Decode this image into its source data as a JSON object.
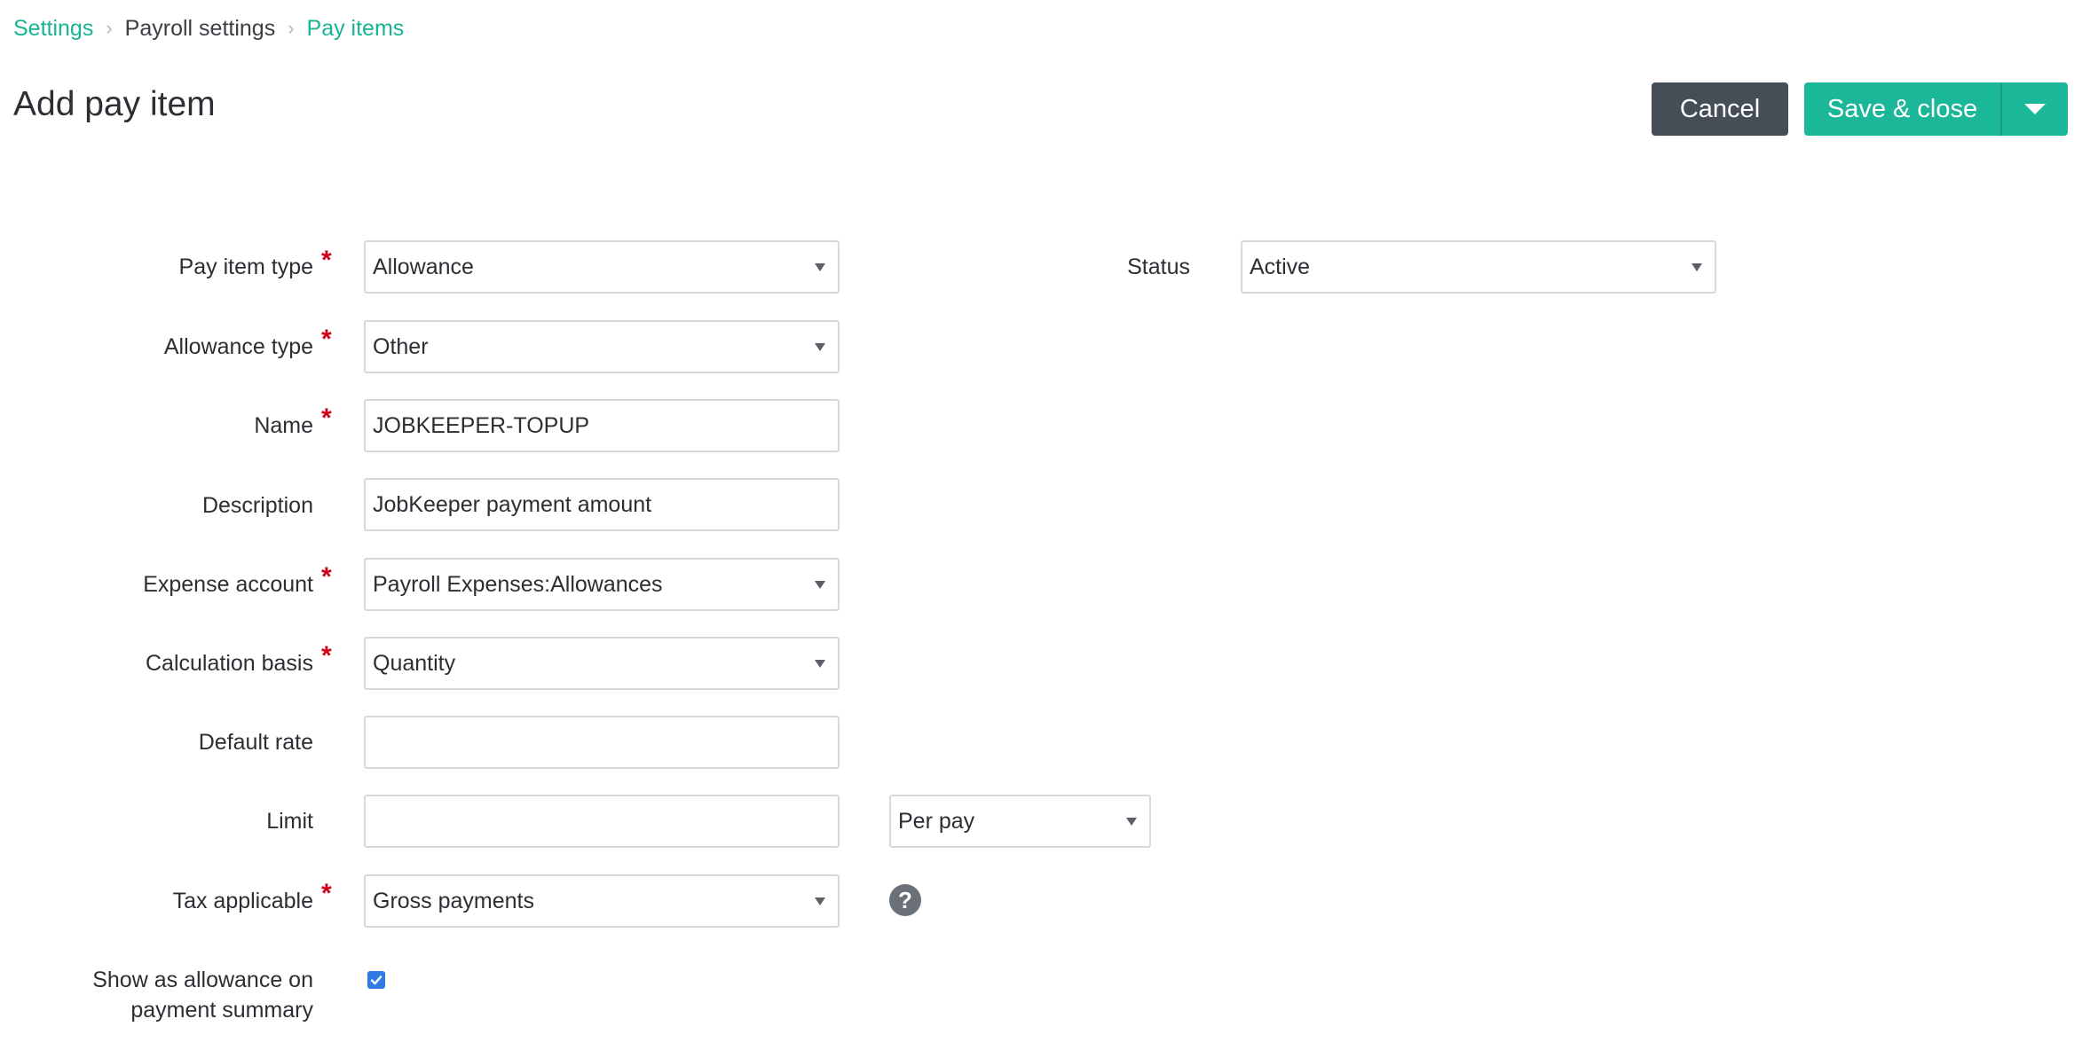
{
  "breadcrumb": {
    "items": [
      {
        "label": "Settings",
        "link": true
      },
      {
        "label": "Payroll settings",
        "link": false
      },
      {
        "label": "Pay items",
        "link": true
      }
    ],
    "separator": "›"
  },
  "page": {
    "title": "Add pay item"
  },
  "actions": {
    "cancel_label": "Cancel",
    "save_label": "Save & close"
  },
  "form": {
    "pay_item_type": {
      "label": "Pay item type",
      "required": true,
      "value": "Allowance"
    },
    "status": {
      "label": "Status",
      "value": "Active"
    },
    "allowance_type": {
      "label": "Allowance type",
      "required": true,
      "value": "Other"
    },
    "name": {
      "label": "Name",
      "required": true,
      "value": "JOBKEEPER-TOPUP"
    },
    "description": {
      "label": "Description",
      "required": false,
      "value": "JobKeeper payment amount"
    },
    "expense_account": {
      "label": "Expense account",
      "required": true,
      "value": "Payroll Expenses:Allowances"
    },
    "calculation_basis": {
      "label": "Calculation basis",
      "required": true,
      "value": "Quantity"
    },
    "default_rate": {
      "label": "Default rate",
      "required": false,
      "value": ""
    },
    "limit": {
      "label": "Limit",
      "required": false,
      "value": "",
      "period": "Per pay"
    },
    "tax_applicable": {
      "label": "Tax applicable",
      "required": true,
      "value": "Gross payments",
      "help": "?"
    },
    "show_as_allowance": {
      "label_line1": "Show as allowance on",
      "label_line2": "payment summary",
      "checked": true
    }
  },
  "required_marker": "*",
  "colors": {
    "accent": "#1ab798",
    "link": "#19b394",
    "cancel_bg": "#454d57",
    "required": "#d0021b",
    "checkbox": "#2f7ae5"
  }
}
